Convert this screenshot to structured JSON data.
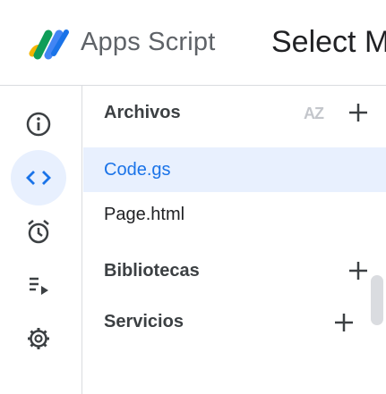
{
  "header": {
    "app_name": "Apps Script",
    "project_title": "Select M",
    "logo_icon": "apps-script-logo"
  },
  "rail": {
    "items": [
      {
        "icon": "info-icon",
        "active": false
      },
      {
        "icon": "code-icon",
        "active": true
      },
      {
        "icon": "alarm-clock-icon",
        "active": false
      },
      {
        "icon": "executions-icon",
        "active": false
      },
      {
        "icon": "gear-icon",
        "active": false
      }
    ]
  },
  "panel": {
    "files_title": "Archivos",
    "sort_label": "AZ",
    "files": [
      {
        "name": "Code.gs",
        "selected": true
      },
      {
        "name": "Page.html",
        "selected": false
      }
    ],
    "libraries_title": "Bibliotecas",
    "services_title": "Servicios"
  },
  "colors": {
    "accent": "#1a73e8",
    "selected_bg": "#e8f0fe",
    "border": "#dadce0",
    "icon": "#5f6368"
  }
}
